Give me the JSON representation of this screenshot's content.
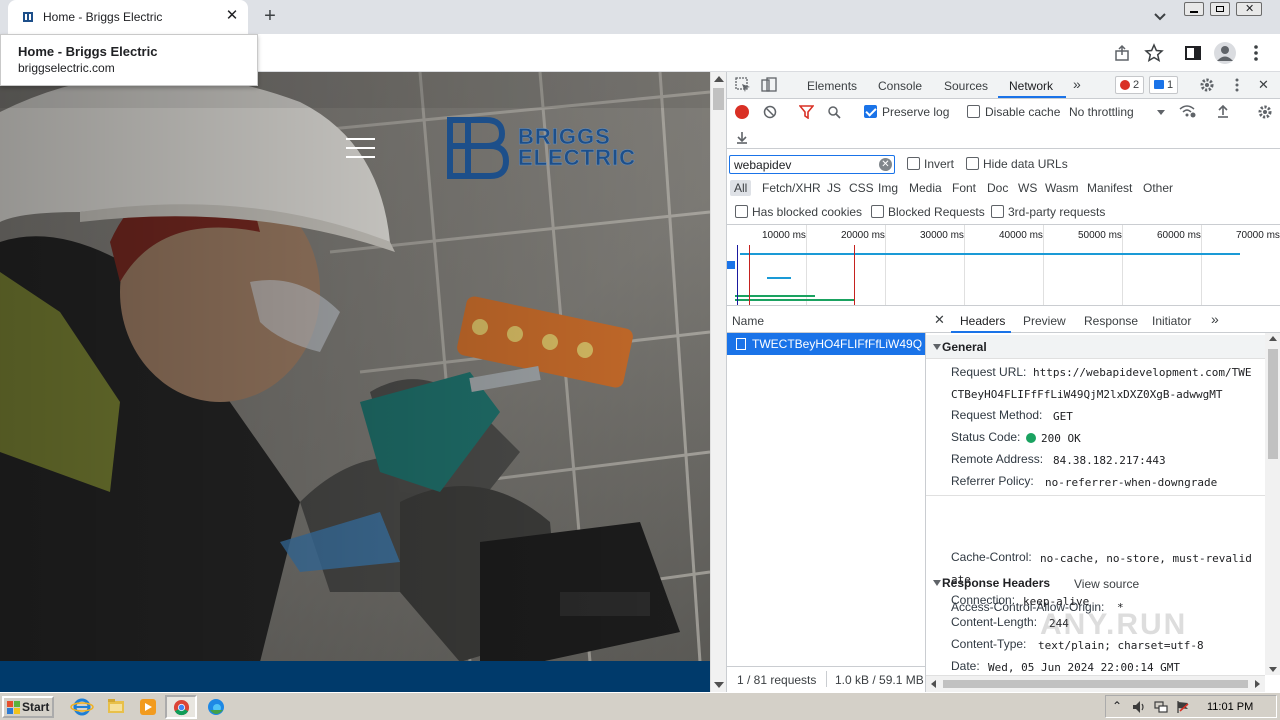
{
  "browser": {
    "tab_title": "Home - Briggs Electric",
    "tooltip_title": "Home - Briggs Electric",
    "tooltip_url": "briggselectric.com"
  },
  "site": {
    "logo_line1": "BRIGGS",
    "logo_line2": "ELECTRIC",
    "brand_color": "#1d4f8a",
    "footer_color": "#003a6b"
  },
  "devtools": {
    "tabs": [
      "Elements",
      "Console",
      "Sources",
      "Network"
    ],
    "active_tab": "Network",
    "errors_count": "2",
    "messages_count": "1",
    "preserve_log": "Preserve log",
    "disable_cache": "Disable cache",
    "throttling": "No throttling",
    "filter_value": "webapidev",
    "invert": "Invert",
    "hide_data_urls": "Hide data URLs",
    "filter_types": [
      "All",
      "Fetch/XHR",
      "JS",
      "CSS",
      "Img",
      "Media",
      "Font",
      "Doc",
      "WS",
      "Wasm",
      "Manifest",
      "Other"
    ],
    "has_blocked_cookies": "Has blocked cookies",
    "blocked_requests": "Blocked Requests",
    "third_party": "3rd-party requests",
    "overview_ticks": [
      "10000 ms",
      "20000 ms",
      "30000 ms",
      "40000 ms",
      "50000 ms",
      "60000 ms",
      "70000 ms"
    ],
    "name_header": "Name",
    "request_name": "TWECTBeyHO4FLIFfFfLiW49Q...",
    "footer_requests": "1 / 81 requests",
    "footer_transfer": "1.0 kB / 59.1 MB",
    "detail_tabs": [
      "Headers",
      "Preview",
      "Response",
      "Initiator"
    ],
    "general_title": "General",
    "general": {
      "request_url_key": "Request URL:",
      "request_url_val1": "https://webapidevelopment.com/TWE",
      "request_url_val2": "CTBeyHO4FLIFfFfLiW49QjM2lxDXZ0XgB-adwwgMT",
      "method_key": "Request Method:",
      "method_val": "GET",
      "status_key": "Status Code:",
      "status_val": "200 OK",
      "remote_key": "Remote Address:",
      "remote_val": "84.38.182.217:443",
      "referrer_key": "Referrer Policy:",
      "referrer_val": "no-referrer-when-downgrade"
    },
    "response_title": "Response Headers",
    "view_source": "View source",
    "response": {
      "acao_key": "Access-Control-Allow-Origin:",
      "acao_val": "*",
      "cache_key": "Cache-Control:",
      "cache_val1": "no-cache, no-store, must-revalid",
      "cache_val2": "ate",
      "conn_key": "Connection:",
      "conn_val": "keep-alive",
      "len_key": "Content-Length:",
      "len_val": "244",
      "type_key": "Content-Type:",
      "type_val": "text/plain; charset=utf-8",
      "date_key": "Date:",
      "date_val": "Wed, 05 Jun 2024 22:00:14 GMT"
    }
  },
  "taskbar": {
    "start": "Start",
    "clock": "11:01 PM"
  },
  "watermark": "ANY.RUN"
}
